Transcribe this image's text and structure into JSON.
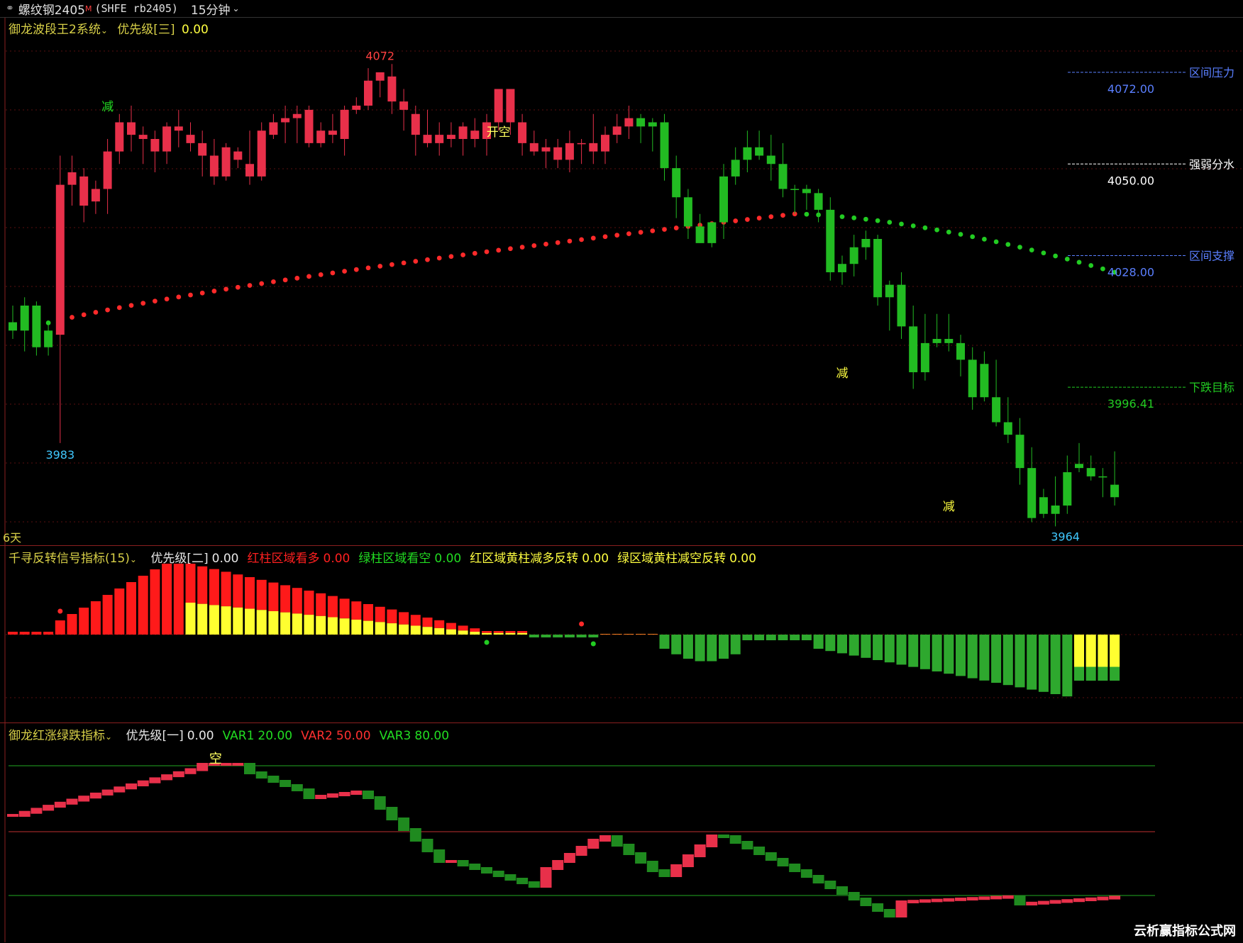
{
  "header": {
    "link_icon": "link-icon",
    "symbol": "螺纹钢2405",
    "superscript": "M",
    "code": "(SHFE rb2405)",
    "period": "15分钟",
    "chevron": "chevron-down-icon"
  },
  "main_panel": {
    "indicator_name": "御龙波段王2系统",
    "priority_label": "优先级[三]",
    "priority_value": "0.00",
    "high_label": "4072",
    "low_label_left": "3983",
    "low_label_right": "3964",
    "days_label": "6天",
    "signals": [
      "减",
      "开空",
      "减",
      "减"
    ],
    "levels": [
      {
        "name": "区间压力",
        "value": "4072.00",
        "color": "#5a7fff"
      },
      {
        "name": "强弱分水",
        "value": "4050.00",
        "color": "#ffffff"
      },
      {
        "name": "区间支撑",
        "value": "4028.00",
        "color": "#5a7fff"
      },
      {
        "name": "下跌目标",
        "value": "3996.41",
        "color": "#22cc22"
      }
    ],
    "price_range": [
      3960,
      4080
    ]
  },
  "panel2": {
    "indicator_name": "千寻反转信号指标(15)",
    "items": [
      {
        "label": "优先级[二]",
        "value": "0.00",
        "color": "#e8e8e8"
      },
      {
        "label": "红柱区域看多",
        "value": "0.00",
        "color": "#ff2020"
      },
      {
        "label": "绿柱区域看空",
        "value": "0.00",
        "color": "#22dd22"
      },
      {
        "label": "红区域黄柱减多反转",
        "value": "0.00",
        "color": "#ffff40"
      },
      {
        "label": "绿区域黄柱减空反转",
        "value": "0.00",
        "color": "#ffff40"
      }
    ]
  },
  "panel3": {
    "indicator_name": "御龙红涨绿跌指标",
    "items": [
      {
        "label": "优先级[一]",
        "value": "0.00",
        "color": "#e8e8e8"
      },
      {
        "label": "VAR1",
        "value": "20.00",
        "color": "#22dd22"
      },
      {
        "label": "VAR2",
        "value": "50.00",
        "color": "#ff3030"
      },
      {
        "label": "VAR3",
        "value": "80.00",
        "color": "#22dd22"
      }
    ],
    "signal": "空"
  },
  "chart_data": {
    "type": "candlestick",
    "candles": [
      [
        4012,
        4016,
        4008,
        4010
      ],
      [
        4010,
        4018,
        4005,
        4016
      ],
      [
        4016,
        4017,
        4004,
        4006
      ],
      [
        4006,
        4012,
        4004,
        4010
      ],
      [
        4009,
        4052,
        3983,
        4045
      ],
      [
        4045,
        4052,
        4040,
        4048
      ],
      [
        4047,
        4049,
        4036,
        4040
      ],
      [
        4041,
        4046,
        4038,
        4044
      ],
      [
        4044,
        4056,
        4038,
        4053
      ],
      [
        4053,
        4062,
        4050,
        4060
      ],
      [
        4060,
        4064,
        4053,
        4057
      ],
      [
        4057,
        4059,
        4050,
        4056
      ],
      [
        4056,
        4058,
        4048,
        4053
      ],
      [
        4053,
        4060,
        4050,
        4059
      ],
      [
        4059,
        4063,
        4054,
        4058
      ],
      [
        4057,
        4060,
        4053,
        4055
      ],
      [
        4055,
        4058,
        4047,
        4052
      ],
      [
        4052,
        4056,
        4045,
        4047
      ],
      [
        4047,
        4055,
        4046,
        4054
      ],
      [
        4053,
        4054,
        4049,
        4051
      ],
      [
        4050,
        4058,
        4045,
        4047
      ],
      [
        4047,
        4060,
        4046,
        4058
      ],
      [
        4057,
        4062,
        4056,
        4060
      ],
      [
        4060,
        4064,
        4055,
        4061
      ],
      [
        4061,
        4064,
        4055,
        4062
      ],
      [
        4063,
        4064,
        4054,
        4055
      ],
      [
        4055,
        4060,
        4054,
        4058
      ],
      [
        4058,
        4062,
        4055,
        4057
      ],
      [
        4056,
        4064,
        4052,
        4063
      ],
      [
        4063,
        4066,
        4062,
        4064
      ],
      [
        4064,
        4073,
        4063,
        4070
      ],
      [
        4070,
        4072,
        4066,
        4072
      ],
      [
        4071,
        4074,
        4062,
        4065
      ],
      [
        4065,
        4068,
        4058,
        4063
      ],
      [
        4062,
        4064,
        4052,
        4057
      ],
      [
        4057,
        4063,
        4054,
        4055
      ],
      [
        4055,
        4060,
        4052,
        4057
      ],
      [
        4057,
        4060,
        4054,
        4056
      ],
      [
        4056,
        4060,
        4052,
        4059
      ],
      [
        4058,
        4061,
        4054,
        4056
      ],
      [
        4056,
        4062,
        4052,
        4060
      ],
      [
        4060,
        4068,
        4058,
        4068
      ],
      [
        4068,
        4068,
        4057,
        4060
      ],
      [
        4060,
        4062,
        4052,
        4055
      ],
      [
        4055,
        4058,
        4052,
        4053
      ],
      [
        4053,
        4056,
        4049,
        4054
      ],
      [
        4054,
        4056,
        4049,
        4051
      ],
      [
        4051,
        4058,
        4048,
        4055
      ],
      [
        4055,
        4056,
        4050,
        4055
      ],
      [
        4055,
        4062,
        4050,
        4053
      ],
      [
        4053,
        4059,
        4050,
        4057
      ],
      [
        4057,
        4062,
        4055,
        4059
      ],
      [
        4059,
        4064,
        4056,
        4061
      ],
      [
        4061,
        4062,
        4055,
        4059
      ],
      [
        4059,
        4061,
        4053,
        4060
      ],
      [
        4060,
        4062,
        4046,
        4049
      ],
      [
        4049,
        4052,
        4037,
        4042
      ],
      [
        4042,
        4044,
        4032,
        4035
      ],
      [
        4035,
        4038,
        4031,
        4031
      ],
      [
        4031,
        4035,
        4030,
        4036
      ],
      [
        4036,
        4050,
        4032,
        4047
      ],
      [
        4047,
        4054,
        4045,
        4051
      ],
      [
        4051,
        4058,
        4048,
        4054
      ],
      [
        4054,
        4058,
        4051,
        4052
      ],
      [
        4052,
        4057,
        4046,
        4050
      ],
      [
        4050,
        4055,
        4042,
        4044
      ],
      [
        4044,
        4045,
        4038,
        4044
      ],
      [
        4044,
        4045,
        4039,
        4043
      ],
      [
        4043,
        4044,
        4036,
        4039
      ],
      [
        4039,
        4042,
        4022,
        4024
      ],
      [
        4024,
        4028,
        4021,
        4026
      ],
      [
        4026,
        4033,
        4023,
        4030
      ],
      [
        4030,
        4034,
        4027,
        4032
      ],
      [
        4032,
        4033,
        4016,
        4018
      ],
      [
        4018,
        4022,
        4010,
        4021
      ],
      [
        4021,
        4024,
        4008,
        4011
      ],
      [
        4011,
        4016,
        3996,
        4000
      ],
      [
        4000,
        4014,
        3998,
        4007
      ],
      [
        4007,
        4014,
        4006,
        4008
      ],
      [
        4008,
        4014,
        4005,
        4007
      ],
      [
        4007,
        4009,
        3999,
        4003
      ],
      [
        4003,
        4006,
        3991,
        3994
      ],
      [
        4002,
        4005,
        3993,
        3994
      ],
      [
        3994,
        4003,
        3987,
        3988
      ],
      [
        3988,
        3994,
        3983,
        3985
      ],
      [
        3985,
        3989,
        3973,
        3977
      ],
      [
        3977,
        3982,
        3964,
        3965
      ],
      [
        3970,
        3972,
        3965,
        3966
      ],
      [
        3966,
        3975,
        3963,
        3968
      ],
      [
        3968,
        3980,
        3966,
        3976
      ],
      [
        3977,
        3983,
        3976,
        3978
      ],
      [
        3977,
        3980,
        3974,
        3975
      ],
      [
        3975,
        3977,
        3970,
        3975
      ],
      [
        3973,
        3981,
        3968,
        3970
      ]
    ],
    "stop_line_start": 4009,
    "stop_line_peak": 4038,
    "stop_line_end": 4024
  }
}
